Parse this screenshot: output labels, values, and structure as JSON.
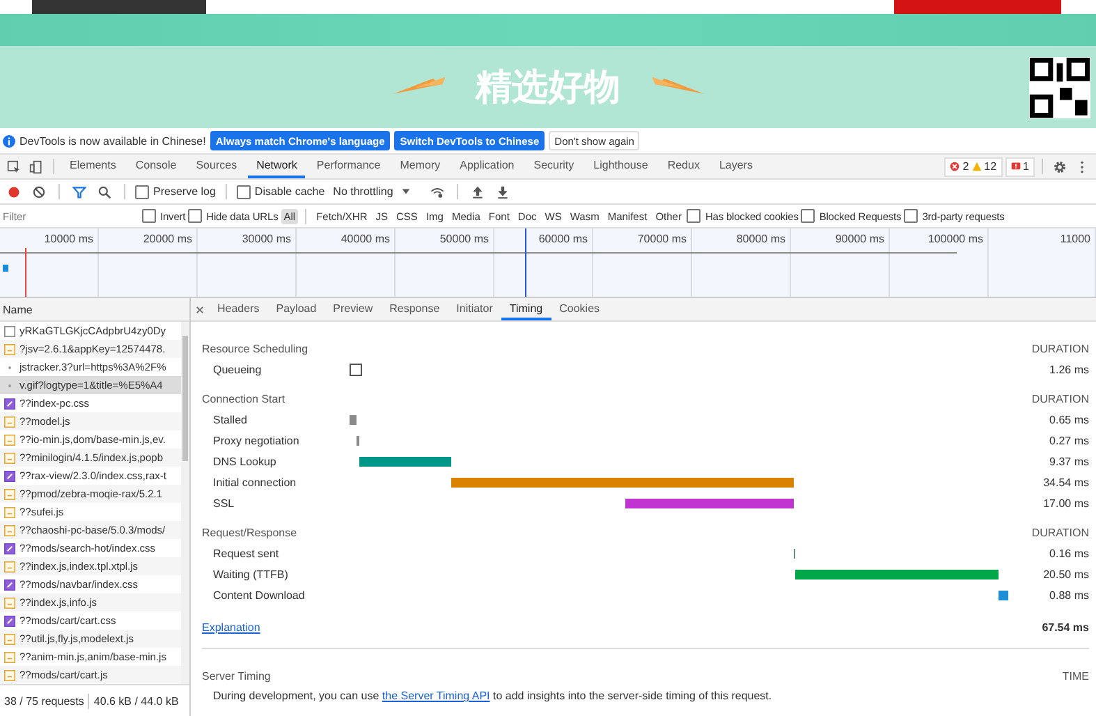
{
  "page": {
    "banner_title": "精选好物"
  },
  "infobar": {
    "message": "DevTools is now available in Chinese!",
    "buttons": [
      {
        "label": "Always match Chrome's language",
        "kind": "primary"
      },
      {
        "label": "Switch DevTools to Chinese",
        "kind": "primary"
      },
      {
        "label": "Don't show again",
        "kind": "plain"
      }
    ]
  },
  "tabs": [
    {
      "label": "Elements",
      "selected": false
    },
    {
      "label": "Console",
      "selected": false
    },
    {
      "label": "Sources",
      "selected": false
    },
    {
      "label": "Network",
      "selected": true
    },
    {
      "label": "Performance",
      "selected": false
    },
    {
      "label": "Memory",
      "selected": false
    },
    {
      "label": "Application",
      "selected": false
    },
    {
      "label": "Security",
      "selected": false
    },
    {
      "label": "Lighthouse",
      "selected": false
    },
    {
      "label": "Redux",
      "selected": false
    },
    {
      "label": "Layers",
      "selected": false
    }
  ],
  "counters": {
    "errors": "2",
    "warnings": "12",
    "issues": "1"
  },
  "toolbar": {
    "preserve_log": {
      "label": "Preserve log",
      "checked": false
    },
    "disable_cache": {
      "label": "Disable cache",
      "checked": false
    },
    "throttling": "No throttling"
  },
  "filter": {
    "placeholder": "Filter",
    "options": [
      {
        "label": "Invert",
        "checked": false
      },
      {
        "label": "Hide data URLs",
        "checked": false
      }
    ],
    "types": [
      {
        "label": "All",
        "selected": true
      },
      {
        "label": "Fetch/XHR",
        "selected": false
      },
      {
        "label": "JS",
        "selected": false
      },
      {
        "label": "CSS",
        "selected": false
      },
      {
        "label": "Img",
        "selected": false
      },
      {
        "label": "Media",
        "selected": false
      },
      {
        "label": "Font",
        "selected": false
      },
      {
        "label": "Doc",
        "selected": false
      },
      {
        "label": "WS",
        "selected": false
      },
      {
        "label": "Wasm",
        "selected": false
      },
      {
        "label": "Manifest",
        "selected": false
      },
      {
        "label": "Other",
        "selected": false
      }
    ],
    "extra_options": [
      {
        "label": "Has blocked cookies",
        "checked": false
      },
      {
        "label": "Blocked Requests",
        "checked": false
      },
      {
        "label": "3rd-party requests",
        "checked": false
      }
    ]
  },
  "overview": {
    "ticks": [
      "10000 ms",
      "20000 ms",
      "30000 ms",
      "40000 ms",
      "50000 ms",
      "60000 ms",
      "70000 ms",
      "80000 ms",
      "90000 ms",
      "100000 ms",
      "11000"
    ]
  },
  "requests": {
    "column": "Name",
    "rows": [
      {
        "name": "yRKaGTLGKjcCAdpbrU4zy0Dy",
        "kind": "document",
        "selected": false
      },
      {
        "name": "?jsv=2.6.1&appKey=12574478.",
        "kind": "script",
        "selected": false
      },
      {
        "name": "jstracker.3?url=https%3A%2F%",
        "kind": "other",
        "selected": false
      },
      {
        "name": "v.gif?logtype=1&title=%E5%A4",
        "kind": "other",
        "selected": true
      },
      {
        "name": "??index-pc.css",
        "kind": "stylesheet",
        "selected": false
      },
      {
        "name": "??model.js",
        "kind": "script",
        "selected": false
      },
      {
        "name": "??io-min.js,dom/base-min.js,ev.",
        "kind": "script",
        "selected": false
      },
      {
        "name": "??minilogin/4.1.5/index.js,popb",
        "kind": "script",
        "selected": false
      },
      {
        "name": "??rax-view/2.3.0/index.css,rax-t",
        "kind": "stylesheet",
        "selected": false
      },
      {
        "name": "??pmod/zebra-moqie-rax/5.2.1",
        "kind": "script",
        "selected": false
      },
      {
        "name": "??sufei.js",
        "kind": "script",
        "selected": false
      },
      {
        "name": "??chaoshi-pc-base/5.0.3/mods/",
        "kind": "script",
        "selected": false
      },
      {
        "name": "??mods/search-hot/index.css",
        "kind": "stylesheet",
        "selected": false
      },
      {
        "name": "??index.js,index.tpl.xtpl.js",
        "kind": "script",
        "selected": false
      },
      {
        "name": "??mods/navbar/index.css",
        "kind": "stylesheet",
        "selected": false
      },
      {
        "name": "??index.js,info.js",
        "kind": "script",
        "selected": false
      },
      {
        "name": "??mods/cart/cart.css",
        "kind": "stylesheet",
        "selected": false
      },
      {
        "name": "??util.js,fly.js,modelext.js",
        "kind": "script",
        "selected": false
      },
      {
        "name": "??anim-min.js,anim/base-min.js",
        "kind": "script",
        "selected": false
      },
      {
        "name": "??mods/cart/cart.js",
        "kind": "script",
        "selected": false
      }
    ]
  },
  "status": {
    "requests": "38 / 75 requests",
    "transferred": "40.6 kB / 44.0 kB"
  },
  "detail": {
    "tabs": [
      {
        "label": "Headers",
        "selected": false
      },
      {
        "label": "Payload",
        "selected": false
      },
      {
        "label": "Preview",
        "selected": false
      },
      {
        "label": "Response",
        "selected": false
      },
      {
        "label": "Initiator",
        "selected": false
      },
      {
        "label": "Timing",
        "selected": true
      },
      {
        "label": "Cookies",
        "selected": false
      }
    ],
    "sections": [
      {
        "title": "Resource Scheduling",
        "column": "DURATION",
        "rows": [
          {
            "label": "Queueing",
            "kind": "box",
            "duration": "1.26 ms"
          }
        ]
      },
      {
        "title": "Connection Start",
        "column": "DURATION",
        "rows": [
          {
            "label": "Stalled",
            "kind": "bar",
            "color": "#8a8a8a",
            "duration": "0.65 ms"
          },
          {
            "label": "Proxy negotiation",
            "kind": "bar",
            "color": "#8a8a8a",
            "duration": "0.27 ms"
          },
          {
            "label": "DNS Lookup",
            "kind": "bar",
            "color": "#009688",
            "duration": "9.37 ms"
          },
          {
            "label": "Initial connection",
            "kind": "bar",
            "color": "#d98200",
            "duration": "34.54 ms"
          },
          {
            "label": "SSL",
            "kind": "overlap",
            "color": "#c035cf",
            "duration": "17.00 ms"
          }
        ]
      },
      {
        "title": "Request/Response",
        "column": "DURATION",
        "rows": [
          {
            "label": "Request sent",
            "kind": "bar",
            "color": "#6a8a7a",
            "duration": "0.16 ms"
          },
          {
            "label": "Waiting (TTFB)",
            "kind": "bar",
            "color": "#00a84a",
            "duration": "20.50 ms"
          },
          {
            "label": "Content Download",
            "kind": "bar",
            "color": "#1c8fd6",
            "duration": "0.88 ms"
          }
        ]
      }
    ],
    "explanation": "Explanation",
    "total": "67.54 ms",
    "server_timing": {
      "title": "Server Timing",
      "column": "TIME",
      "text_before": "During development, you can use ",
      "link": "the Server Timing API",
      "text_after": " to add insights into the server-side timing of this request."
    }
  }
}
